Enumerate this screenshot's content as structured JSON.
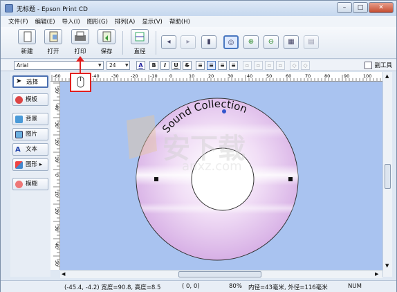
{
  "window": {
    "title": "无标题 - Epson Print CD",
    "min": "–",
    "max": "□",
    "close": "✕"
  },
  "menu": [
    "文件(F)",
    "编辑(E)",
    "导入(I)",
    "图形(G)",
    "排列(A)",
    "显示(V)",
    "帮助(H)"
  ],
  "toolbar": {
    "new": "新建",
    "open": "打开",
    "print": "打印",
    "save": "保存",
    "diameter": "直径"
  },
  "format": {
    "font": "Arial",
    "size": "24",
    "bold": "B",
    "italic": "I",
    "underline": "U",
    "strike": "S",
    "sub_tool": "副工具"
  },
  "ruler": {
    "h_labels": [
      "-60",
      "-50",
      "-40",
      "-30",
      "-20",
      "-10",
      "0",
      "10",
      "20",
      "30",
      "40",
      "50",
      "60",
      "70",
      "80",
      "90",
      "100"
    ],
    "v_labels": [
      "50",
      "40",
      "30",
      "20",
      "10",
      "0",
      "10",
      "20",
      "30",
      "40",
      "50"
    ]
  },
  "left_tools": [
    "选择",
    "模板",
    "背景",
    "图片",
    "文本",
    "图形 ▸",
    "模糊"
  ],
  "canvas": {
    "disc_text": "Sound Collection",
    "watermark_text": "安下载",
    "watermark_sub": "anxz.com",
    "colors": {
      "background": "#a9c3f0",
      "disc": "#e6c9ef"
    }
  },
  "status": {
    "position": "(-45.4, -4.2) 宽度=90.8, 高度=8.5",
    "coords": "(    0,    0)",
    "zoom": "80%",
    "diameters": "内径=43毫米, 外径=116毫米",
    "mode": "NUM"
  },
  "icons": {
    "window": "app-icon",
    "pointer": "mouse-pointer-icon"
  }
}
